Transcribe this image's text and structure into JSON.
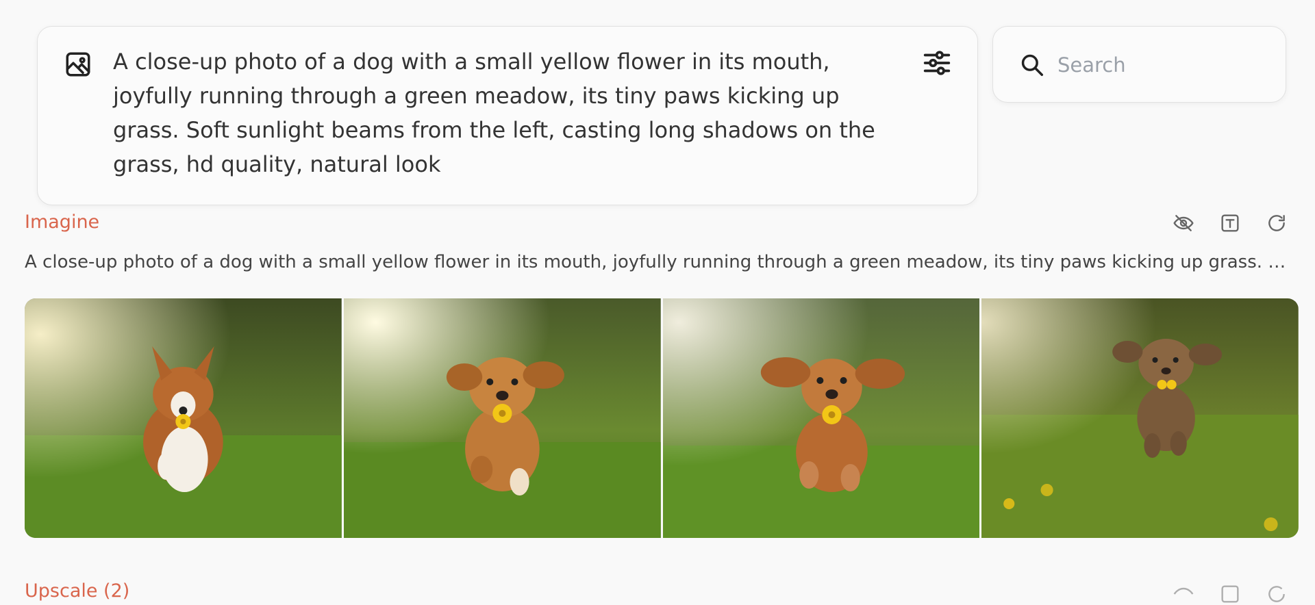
{
  "prompt": {
    "text": "A close-up photo of a dog with a small yellow flower in its mouth, joyfully running through a green meadow, its tiny paws kicking up grass. Soft sunlight beams from the left, casting long shadows on the grass, hd quality, natural look",
    "image_icon": "image-icon",
    "settings_icon": "sliders-icon"
  },
  "search": {
    "placeholder": "Search",
    "value": "",
    "icon": "search-icon"
  },
  "result": {
    "label": "Imagine",
    "caption": "A close-up photo of a dog with a small yellow flower in its mouth, joyfully running through a green meadow, its tiny paws kicking up grass. Soft sunlight beams from the left, casting long shadows on the grass, hd quality, natural look",
    "actions": [
      "eye-off-icon",
      "text-icon",
      "refresh-icon"
    ],
    "images": [
      {
        "name": "generated-image-1"
      },
      {
        "name": "generated-image-2"
      },
      {
        "name": "generated-image-3"
      },
      {
        "name": "generated-image-4"
      }
    ]
  },
  "next_section": {
    "label": "Upscale (2)"
  },
  "colors": {
    "accent": "#d9654c",
    "background": "#f9f9f9",
    "border": "#e1e1e1"
  }
}
